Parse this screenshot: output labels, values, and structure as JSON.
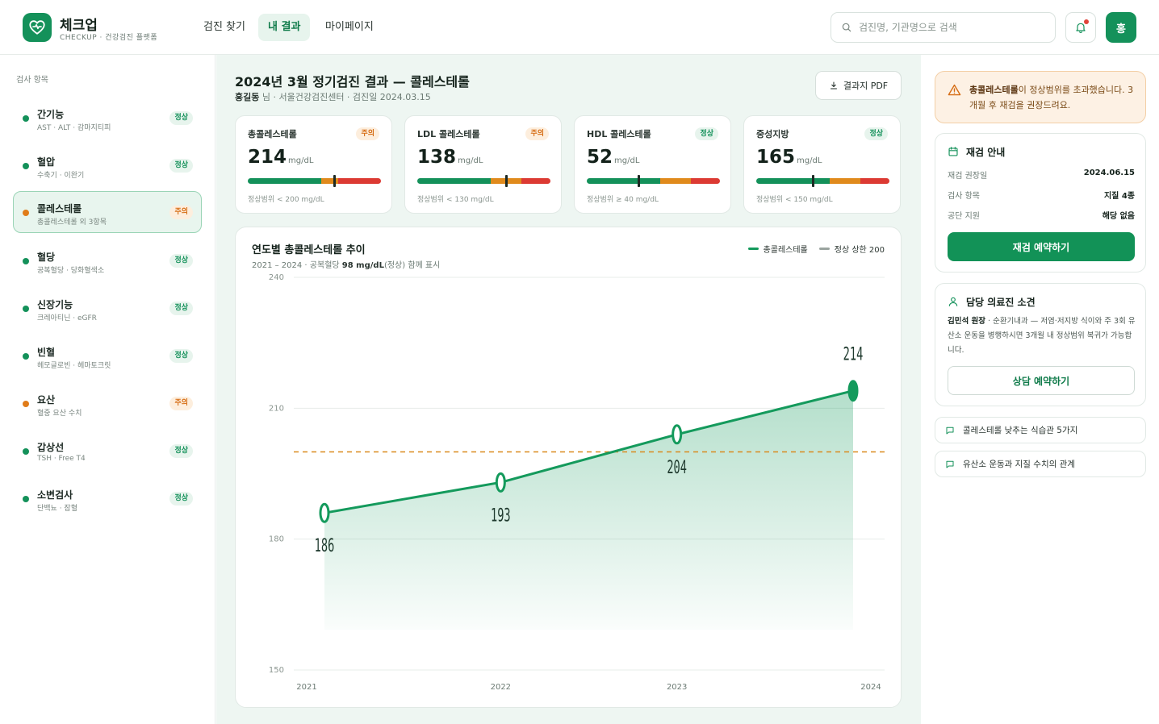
{
  "brand": {
    "name": "체크업",
    "subtitle": "CHECKUP · 건강검진 플랫폼"
  },
  "nav": [
    {
      "label": "검진 찾기",
      "active": false
    },
    {
      "label": "내 결과",
      "active": true
    },
    {
      "label": "마이페이지",
      "active": false
    }
  ],
  "search": {
    "placeholder": "검진명, 기관명으로 검색",
    "value": ""
  },
  "user": {
    "avatar_initial": "홍"
  },
  "sidebar": {
    "title": "검사 항목",
    "items": [
      {
        "name": "간기능",
        "desc": "AST · ALT · 감마지티피",
        "status": "정상",
        "state": "normal"
      },
      {
        "name": "혈압",
        "desc": "수축기 · 이완기",
        "status": "정상",
        "state": "normal"
      },
      {
        "name": "콜레스테롤",
        "desc": "총콜레스테롤 외 3항목",
        "status": "주의",
        "state": "warn",
        "active": true
      },
      {
        "name": "혈당",
        "desc": "공복혈당 · 당화혈색소",
        "status": "정상",
        "state": "normal"
      },
      {
        "name": "신장기능",
        "desc": "크레아티닌 · eGFR",
        "status": "정상",
        "state": "normal"
      },
      {
        "name": "빈혈",
        "desc": "헤모글로빈 · 헤마토크릿",
        "status": "정상",
        "state": "normal"
      },
      {
        "name": "요산",
        "desc": "혈중 요산 수치",
        "status": "주의",
        "state": "warn"
      },
      {
        "name": "갑상선",
        "desc": "TSH · Free T4",
        "status": "정상",
        "state": "normal"
      },
      {
        "name": "소변검사",
        "desc": "단백뇨 · 잠혈",
        "status": "정상",
        "state": "normal"
      }
    ]
  },
  "main": {
    "title": "2024년 3월 정기검진 결과 — 콜레스테롤",
    "patient": "홍길동",
    "sub_rest": " 님 · 서울건강검진센터 · 검진일 2024.03.15",
    "pdf_label": "결과지 PDF"
  },
  "metrics": [
    {
      "label": "총콜레스테롤",
      "badge": "주의",
      "state": "warn",
      "value": "214",
      "unit": "mg/dL",
      "range": "정상범위 < 200 mg/dL",
      "marker": 0.65
    },
    {
      "label": "LDL 콜레스테롤",
      "badge": "주의",
      "state": "warn",
      "value": "138",
      "unit": "mg/dL",
      "range": "정상범위 < 130 mg/dL",
      "marker": 0.67
    },
    {
      "label": "HDL 콜레스테롤",
      "badge": "정상",
      "state": "normal",
      "value": "52",
      "unit": "mg/dL",
      "range": "정상범위 ≥ 40 mg/dL",
      "marker": 0.39
    },
    {
      "label": "중성지방",
      "badge": "정상",
      "state": "normal",
      "value": "165",
      "unit": "mg/dL",
      "range": "정상범위 < 150 mg/dL",
      "marker": 0.43
    }
  ],
  "chart_card": {
    "title": "연도별 총콜레스테롤 추이",
    "sub_prefix": "2021 – 2024 · 공복혈당 ",
    "sub_bold": "98 mg/dL",
    "sub_suffix": "(정상) 함께 표시"
  },
  "chart_data": {
    "type": "area",
    "title": "연도별 총콜레스테롤 추이",
    "x": [
      "2021",
      "2022",
      "2023",
      "2024"
    ],
    "series": [
      {
        "name": "총콜레스테롤",
        "values": [
          186,
          193,
          204,
          214
        ],
        "color": "#149a5c"
      },
      {
        "name": "정상 상한 200",
        "values": [
          200,
          200,
          200,
          200
        ],
        "color": "#d98a1e",
        "style": "dashed"
      }
    ],
    "yticks": [
      150,
      180,
      210,
      240
    ],
    "ylim": [
      150,
      240
    ],
    "grid": true,
    "legend": "top-right"
  },
  "colors": {
    "accent": "#14915a",
    "warn": "#d66d14",
    "danger": "#dc3a33",
    "gauge_green": "#14915a",
    "gauge_orange": "#e08a1c",
    "gauge_red": "#dc3a33"
  },
  "right": {
    "alert_bold": "총콜레스테롤",
    "alert_rest": "이 정상범위를 초과했습니다. 3개월 후 재검을 권장드려요.",
    "recheck": {
      "title": "재검 안내",
      "rows": [
        {
          "key": "재검 권장일",
          "value": "2024.06.15"
        },
        {
          "key": "검사 항목",
          "value": "지질 4종"
        },
        {
          "key": "공단 지원",
          "value": "해당 없음"
        }
      ],
      "button": "재검 예약하기"
    },
    "doctor": {
      "title": "담당 의료진 소견",
      "name": "김민석 원장",
      "text": " · 순환기내과 — 저염·저지방 식이와 주 3회 유산소 운동을 병행하시면 3개월 내 정상범위 복귀가 가능합니다.",
      "button": "상담 예약하기"
    },
    "links": [
      "콜레스테롤 낮추는 식습관 5가지",
      "유산소 운동과 지질 수치의 관계"
    ]
  }
}
